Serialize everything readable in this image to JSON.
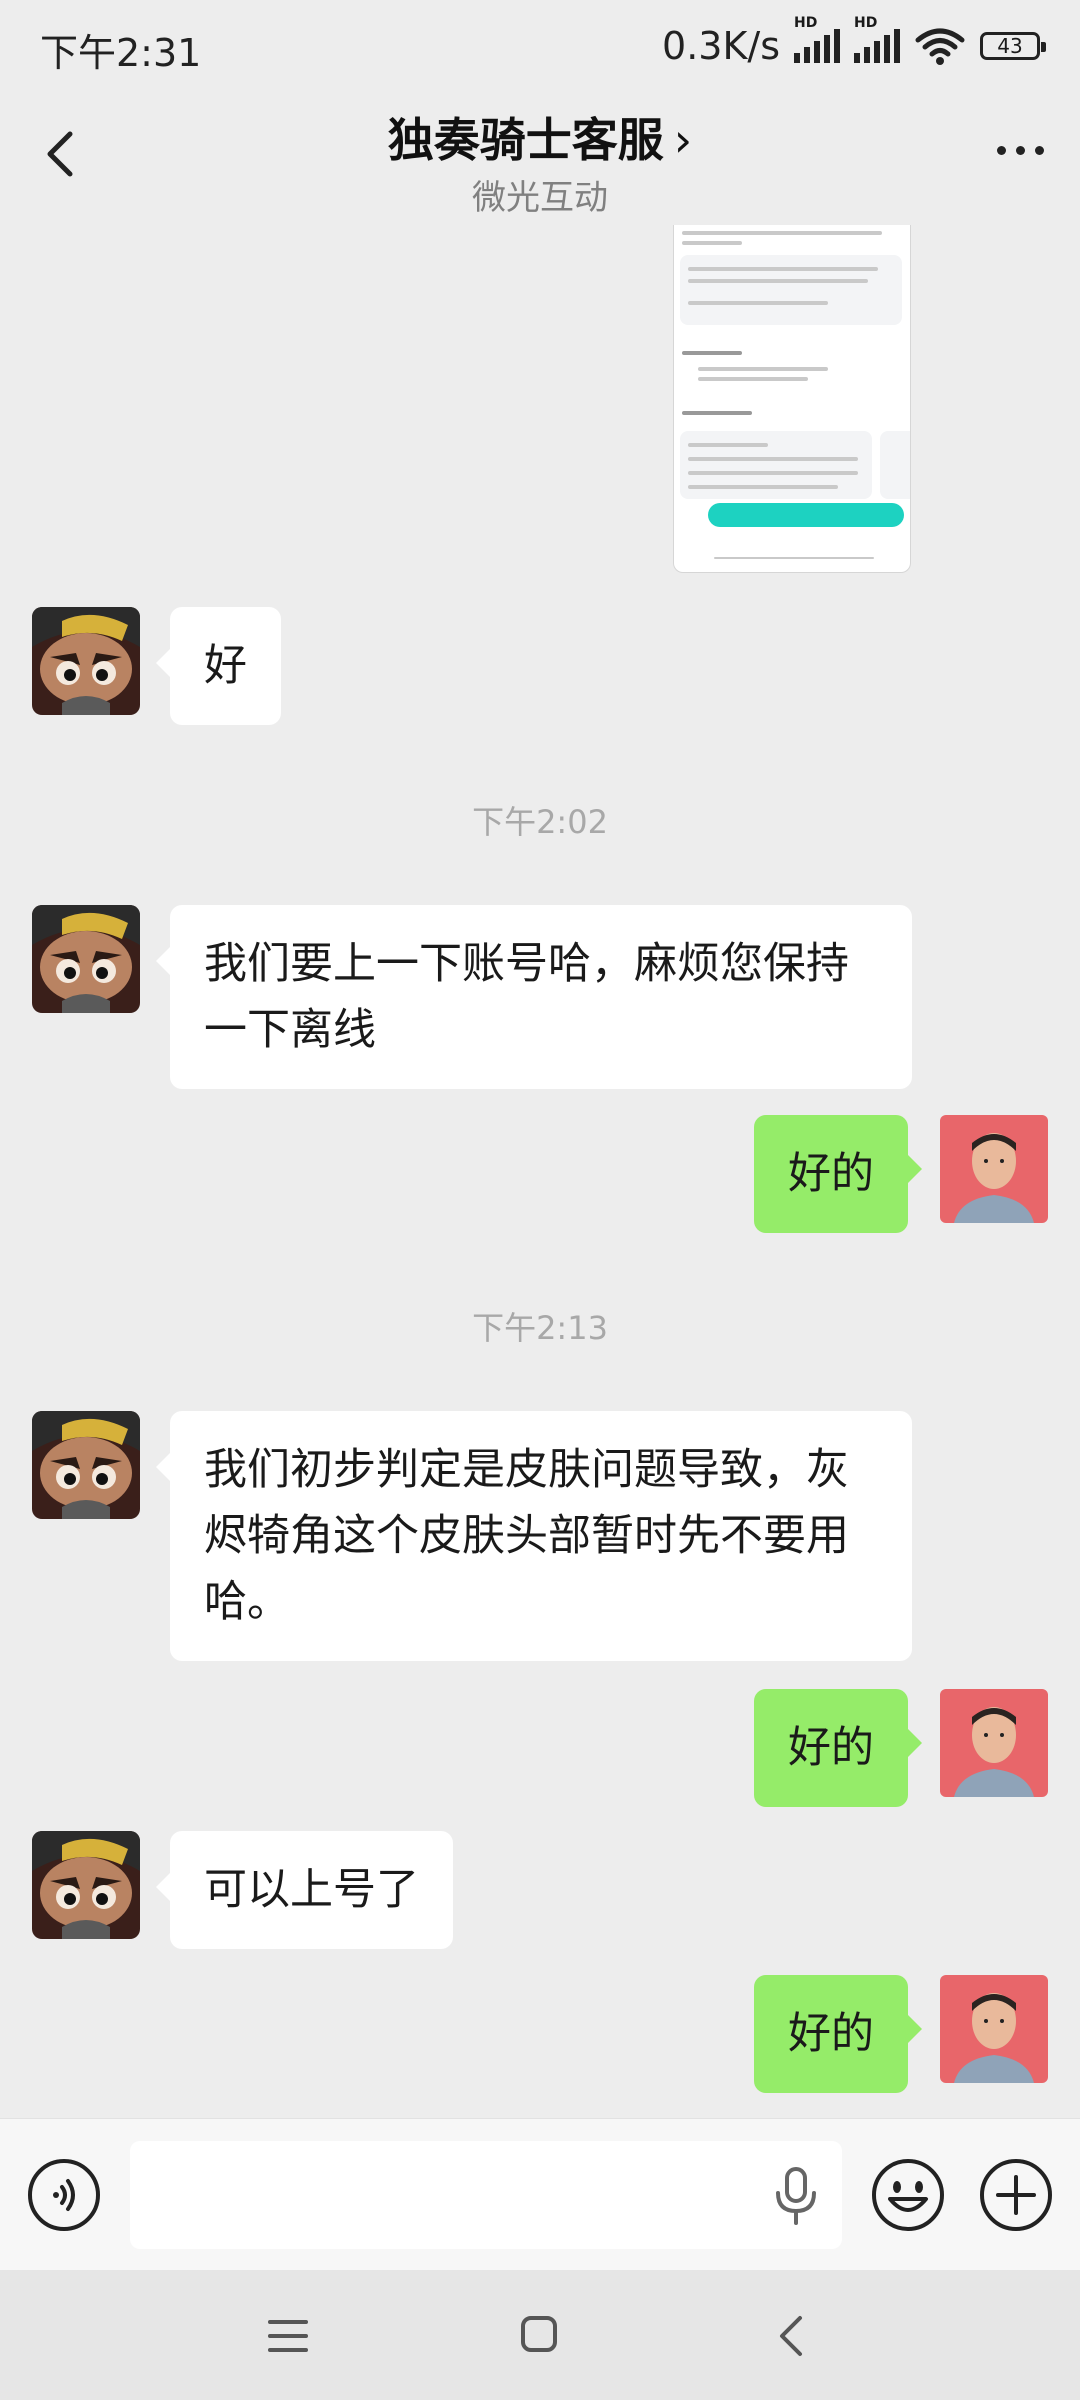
{
  "status_bar": {
    "time": "下午2:31",
    "net_speed": "0.3K/s",
    "sim1_label": "HD",
    "sim2_label": "HD",
    "battery": "43"
  },
  "header": {
    "title": "独奏骑士客服",
    "title_chevron": "›",
    "subtitle": "微光互动",
    "back_icon": "chevron-left-icon",
    "more_icon": "more-dots-icon"
  },
  "messages": [
    {
      "side": "in",
      "text": "好"
    },
    {
      "type": "time",
      "text": "下午2:02"
    },
    {
      "side": "in",
      "text": "我们要上一下账号哈，麻烦您保持一下离线"
    },
    {
      "side": "out",
      "text": "好的"
    },
    {
      "type": "time",
      "text": "下午2:13"
    },
    {
      "side": "in",
      "text": "我们初步判定是皮肤问题导致，灰烬犄角这个皮肤头部暂时先不要用哈。"
    },
    {
      "side": "out",
      "text": "好的"
    },
    {
      "side": "in",
      "text": "可以上号了"
    },
    {
      "side": "out",
      "text": "好的"
    }
  ],
  "input_bar": {
    "placeholder": "",
    "voice_icon": "voice-mode-icon",
    "mic_icon": "microphone-icon",
    "emoji_icon": "emoji-icon",
    "plus_icon": "plus-icon"
  },
  "nav_bar": {
    "menu_icon": "menu-icon",
    "home_icon": "home-square-icon",
    "back_icon": "back-triangle-icon"
  },
  "colors": {
    "background": "#ededed",
    "bubble_out": "#95ec69",
    "bubble_in": "#ffffff",
    "image_accent": "#1dd2c1"
  }
}
